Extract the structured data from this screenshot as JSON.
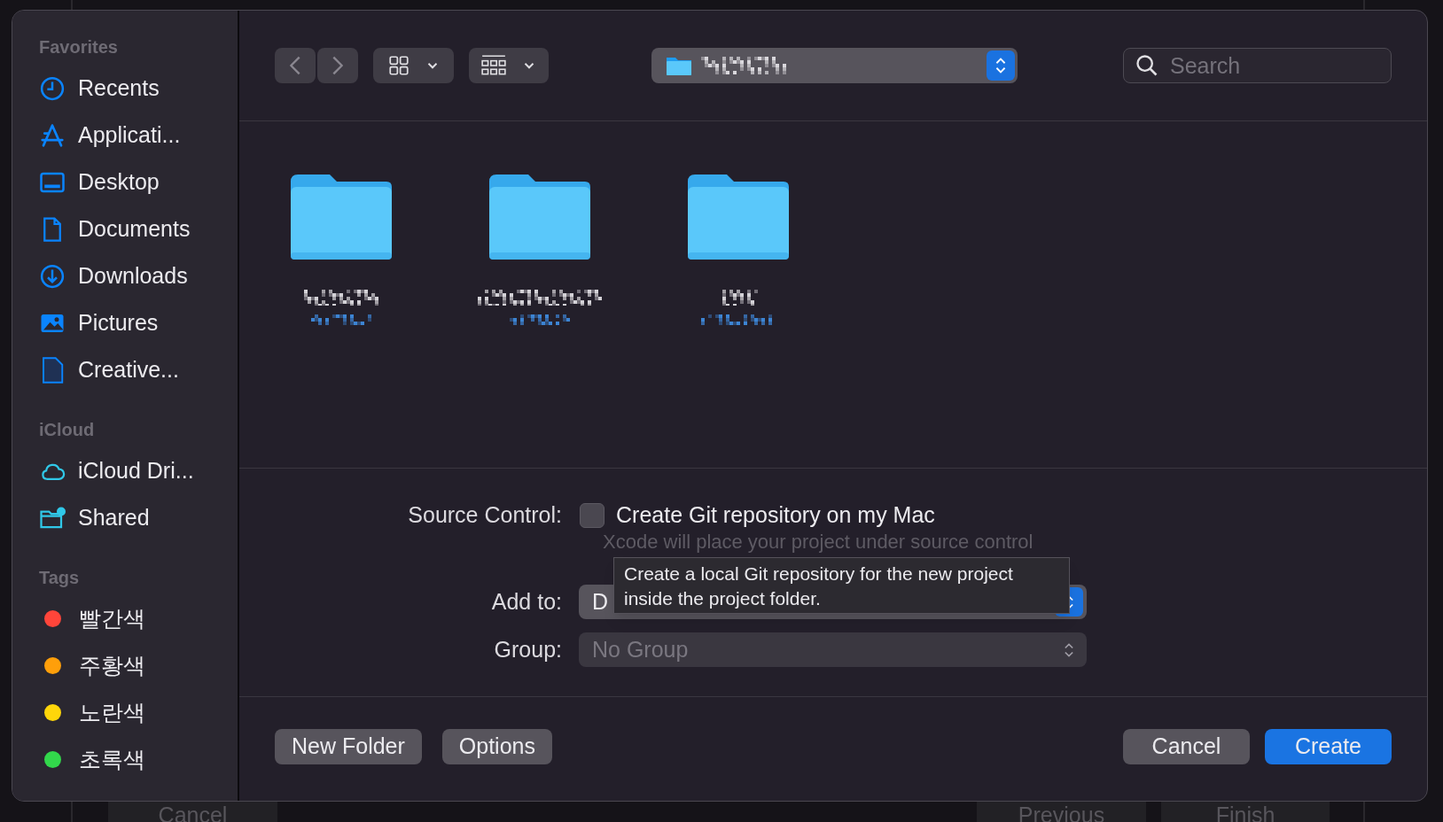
{
  "sidebar": {
    "sections": [
      {
        "title": "Favorites",
        "items": [
          {
            "kind": "place",
            "label": "Recents"
          },
          {
            "kind": "place",
            "label": "Applicati..."
          },
          {
            "kind": "place",
            "label": "Desktop"
          },
          {
            "kind": "place",
            "label": "Documents"
          },
          {
            "kind": "place",
            "label": "Downloads"
          },
          {
            "kind": "place",
            "label": "Pictures"
          },
          {
            "kind": "place",
            "label": "Creative..."
          }
        ]
      },
      {
        "title": "iCloud",
        "items": [
          {
            "kind": "cloud",
            "label": "iCloud Dri..."
          },
          {
            "kind": "cloud",
            "label": "Shared"
          }
        ]
      },
      {
        "title": "Tags",
        "items": [
          {
            "kind": "tag",
            "label": "빨간색",
            "color": "#ff453a"
          },
          {
            "kind": "tag",
            "label": "주황색",
            "color": "#ff9f0a"
          },
          {
            "kind": "tag",
            "label": "노란색",
            "color": "#ffd60a"
          },
          {
            "kind": "tag",
            "label": "초록색",
            "color": "#32d74b"
          }
        ]
      }
    ]
  },
  "toolbar": {
    "search": {
      "placeholder": "Search"
    }
  },
  "folders": [
    {
      "kind": "folder"
    },
    {
      "kind": "folder"
    },
    {
      "kind": "folder"
    }
  ],
  "form": {
    "source_control": {
      "label": "Source Control:",
      "checkbox": {
        "label": "Create Git repository on my Mac",
        "checked": false
      },
      "hint": "Xcode will place your project under source control"
    },
    "add_to": {
      "label": "Add to:",
      "value": "D",
      "disabled": false
    },
    "group": {
      "label": "Group:",
      "value": "No Group",
      "disabled": true
    },
    "tooltip": "Create a local Git repository for the new project\ninside the project folder."
  },
  "buttons_left": [
    "New Folder",
    "Options"
  ],
  "buttons_right": [
    {
      "label": "Cancel",
      "default": false
    },
    {
      "label": "Create",
      "default": true
    }
  ],
  "background_buttons": [
    "Cancel",
    "Previous",
    "Finish"
  ]
}
